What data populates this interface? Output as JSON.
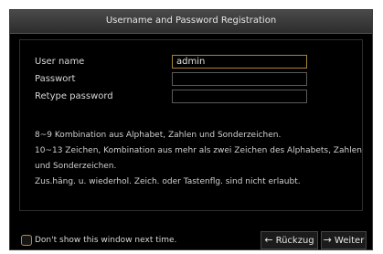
{
  "dialog": {
    "title": "Username and Password Registration"
  },
  "form": {
    "username_label": "User name",
    "username_value": "admin",
    "password_label": "Passwort",
    "password_value": "",
    "retype_label": "Retype password",
    "retype_value": ""
  },
  "hints": [
    "8~9 Kombination aus Alphabet, Zahlen und Sonderzeichen.",
    "10~13 Zeichen, Kombination aus mehr als zwei Zeichen des Alphabets, Zahlen und Sonderzeichen.",
    "Zus.häng. u. wiederhol. Zeich. oder Tastenflg. sind nicht erlaubt."
  ],
  "footer": {
    "dont_show_label": "Don't show this window next time.",
    "dont_show_checked": false,
    "back_label": "Rückzug",
    "back_icon": "arrow-left-icon",
    "next_label": "Weiter",
    "next_icon": "arrow-right-icon"
  },
  "colors": {
    "background": "#000000",
    "accent": "#b08a3a"
  }
}
